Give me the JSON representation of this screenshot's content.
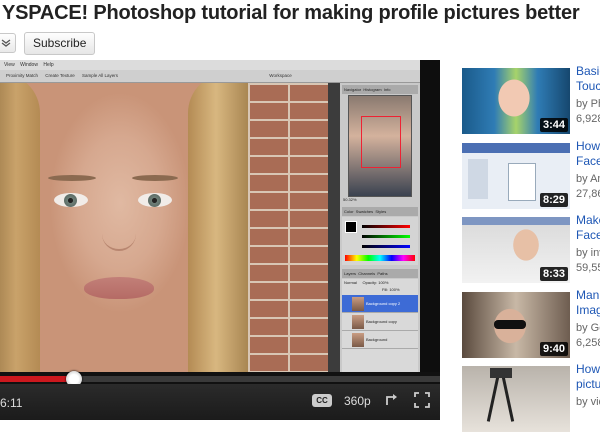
{
  "header": {
    "title": "YSPACE! Photoshop tutorial for making profile pictures better",
    "subscribe_label": "Subscribe"
  },
  "player": {
    "ps_menu": [
      "View",
      "Window",
      "Help"
    ],
    "ps_options": [
      "Proximity Match",
      "Create Texture",
      "Sample All Layers"
    ],
    "ps_workspace": "Workspace",
    "panel_tabs": [
      "Navigator",
      "Histogram",
      "Info"
    ],
    "color_tabs": [
      "Color",
      "Swatches",
      "Styles"
    ],
    "layer_tabs": [
      "Layers",
      "Channels",
      "Paths"
    ],
    "layer_mode": "Normal",
    "layer_opacity": "Opacity: 100%",
    "layer_fill": "Fill: 100%",
    "zoom": "50.32%",
    "layers": [
      "Background copy 2",
      "Background copy",
      "Background"
    ],
    "time": "6:11",
    "cc_label": "CC",
    "quality": "360p",
    "progress": 0.17
  },
  "sidebar": {
    "items": [
      {
        "title1": "Basic",
        "title2": "Touc",
        "by": "by Ph",
        "views": "6,928",
        "duration": "3:44"
      },
      {
        "title1": "How",
        "title2": "Face",
        "by": "by An",
        "views": "27,86",
        "duration": "8:29"
      },
      {
        "title1": "Make",
        "title2": "Face",
        "by": "by inv",
        "views": "59,55",
        "duration": "8:33"
      },
      {
        "title1": "Mani",
        "title2": "Imag",
        "by": "by Go",
        "views": "6,258",
        "duration": "9:40"
      },
      {
        "title1": "How",
        "title2": "pictu",
        "by": "by vid",
        "views": "",
        "duration": ""
      }
    ]
  },
  "colors": {
    "progress": "#cc181e",
    "link": "#1e57b5"
  }
}
